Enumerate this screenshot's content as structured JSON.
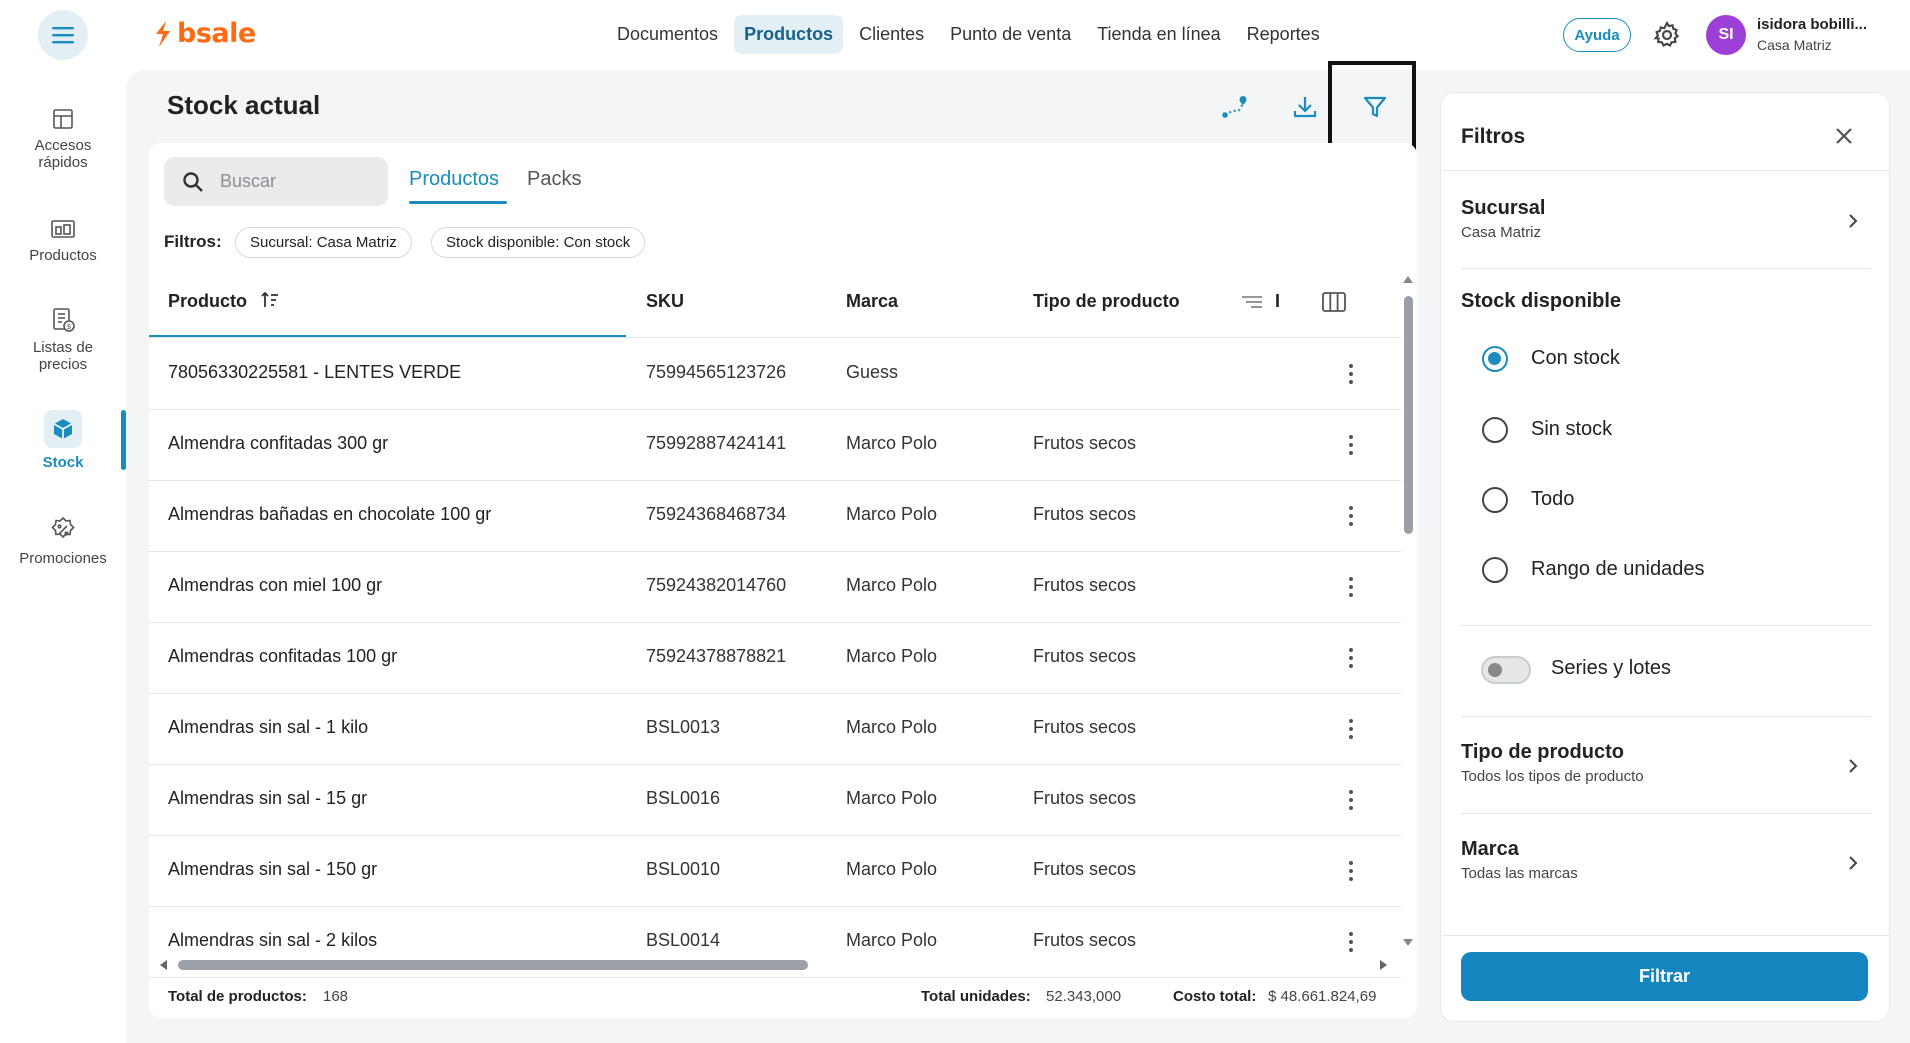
{
  "app": {
    "brand": "bsale"
  },
  "topnav": {
    "items": [
      {
        "label": "Documentos",
        "active": false
      },
      {
        "label": "Productos",
        "active": true
      },
      {
        "label": "Clientes",
        "active": false
      },
      {
        "label": "Punto de venta",
        "active": false
      },
      {
        "label": "Tienda en línea",
        "active": false
      },
      {
        "label": "Reportes",
        "active": false
      }
    ],
    "help_label": "Ayuda",
    "user": {
      "initials": "SI",
      "name": "isidora bobilli...",
      "branch": "Casa Matriz"
    }
  },
  "sidebar": {
    "items": [
      {
        "label_line1": "Accesos",
        "label_line2": "rápidos",
        "icon": "layout-icon"
      },
      {
        "label_line1": "Productos",
        "label_line2": "",
        "icon": "products-icon"
      },
      {
        "label_line1": "Listas de",
        "label_line2": "precios",
        "icon": "price-list-icon"
      },
      {
        "label_line1": "Stock",
        "label_line2": "",
        "icon": "cube-icon",
        "active": true
      },
      {
        "label_line1": "Promociones",
        "label_line2": "",
        "icon": "percent-badge-icon"
      }
    ]
  },
  "page": {
    "title": "Stock actual"
  },
  "toolbar": {
    "icons": [
      "route-icon",
      "download-icon",
      "filter-icon"
    ]
  },
  "search": {
    "placeholder": "Buscar"
  },
  "tabs": [
    {
      "label": "Productos",
      "active": true
    },
    {
      "label": "Packs",
      "active": false
    }
  ],
  "applied_filters": {
    "label": "Filtros:",
    "chips": [
      "Sucursal: Casa Matriz",
      "Stock disponible: Con stock"
    ]
  },
  "table": {
    "columns": [
      "Producto",
      "SKU",
      "Marca",
      "Tipo de producto"
    ],
    "rows": [
      {
        "producto": "78056330225581 - LENTES VERDE",
        "sku": "75994565123726",
        "marca": "Guess",
        "tipo": ""
      },
      {
        "producto": "Almendra confitadas 300 gr",
        "sku": "75992887424141",
        "marca": "Marco Polo",
        "tipo": "Frutos secos"
      },
      {
        "producto": "Almendras bañadas en chocolate 100 gr",
        "sku": "75924368468734",
        "marca": "Marco Polo",
        "tipo": "Frutos secos"
      },
      {
        "producto": "Almendras con miel 100 gr",
        "sku": "75924382014760",
        "marca": "Marco Polo",
        "tipo": "Frutos secos"
      },
      {
        "producto": "Almendras confitadas 100 gr",
        "sku": "75924378878821",
        "marca": "Marco Polo",
        "tipo": "Frutos secos"
      },
      {
        "producto": "Almendras sin sal - 1 kilo",
        "sku": "BSL0013",
        "marca": "Marco Polo",
        "tipo": "Frutos secos"
      },
      {
        "producto": "Almendras sin sal - 15 gr",
        "sku": "BSL0016",
        "marca": "Marco Polo",
        "tipo": "Frutos secos"
      },
      {
        "producto": "Almendras sin sal - 150 gr",
        "sku": "BSL0010",
        "marca": "Marco Polo",
        "tipo": "Frutos secos"
      },
      {
        "producto": "Almendras sin sal - 2 kilos",
        "sku": "BSL0014",
        "marca": "Marco Polo",
        "tipo": "Frutos secos"
      }
    ],
    "header_extra": "I"
  },
  "footer": {
    "total_products_label": "Total de productos:",
    "total_products": "168",
    "total_units_label": "Total unidades:",
    "total_units": "52.343,000",
    "total_cost_label": "Costo total:",
    "total_cost": "$ 48.661.824,69"
  },
  "filter_panel": {
    "title": "Filtros",
    "sucursal": {
      "title": "Sucursal",
      "value": "Casa Matriz"
    },
    "stock": {
      "title": "Stock disponible",
      "options": [
        "Con stock",
        "Sin stock",
        "Todo",
        "Rango de unidades"
      ],
      "selected": "Con stock"
    },
    "series_toggle": {
      "label": "Series y lotes",
      "on": false
    },
    "tipo": {
      "title": "Tipo de producto",
      "value": "Todos los tipos de producto"
    },
    "marca": {
      "title": "Marca",
      "value": "Todas las marcas"
    },
    "submit_label": "Filtrar"
  },
  "colors": {
    "accent": "#1a8cbd",
    "brand": "#ff6a13",
    "avatar": "#9c3fd6",
    "button": "#1585c0"
  }
}
